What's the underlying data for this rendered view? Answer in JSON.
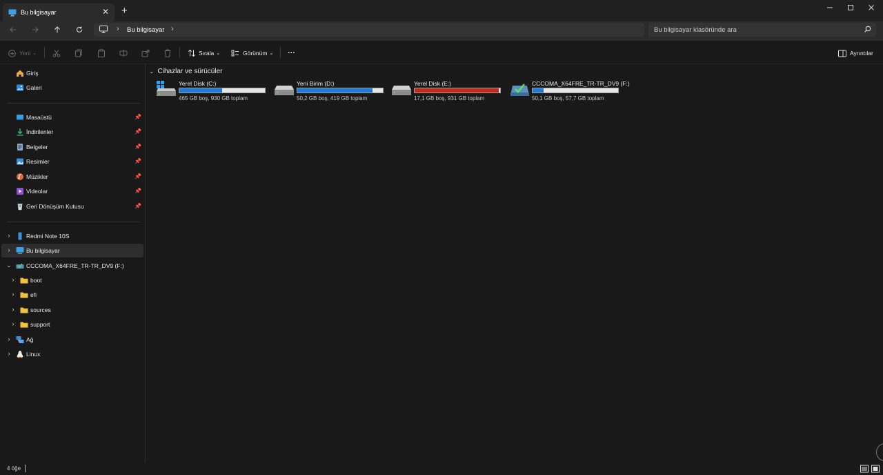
{
  "window": {
    "tab_title": "Bu bilgisayar",
    "tab_icon": "monitor-icon",
    "close_tab": "✕",
    "new_tab": "+",
    "controls": [
      "minimize-icon",
      "maximize-icon",
      "close-icon"
    ]
  },
  "nav": {
    "back_icon": "arrow-left-icon",
    "forward_icon": "arrow-right-icon",
    "up_icon": "arrow-up-icon",
    "refresh_icon": "refresh-icon",
    "address": {
      "crumb": "Bu bilgisayar"
    },
    "search": {
      "placeholder": "Bu bilgisayar klasöründe ara"
    }
  },
  "toolbar": {
    "new_label": "Yeni",
    "sort_label": "Sırala",
    "view_label": "Görünüm",
    "more_label": "···",
    "details_label": "Ayrıntılar"
  },
  "sidebar": {
    "quick": [
      {
        "label": "Giriş",
        "icon": "home-icon"
      },
      {
        "label": "Galeri",
        "icon": "gallery-icon"
      }
    ],
    "pinned": [
      {
        "label": "Masaüstü",
        "icon": "desktop-icon"
      },
      {
        "label": "İndirilenler",
        "icon": "download-icon"
      },
      {
        "label": "Belgeler",
        "icon": "documents-icon"
      },
      {
        "label": "Resimler",
        "icon": "pictures-icon"
      },
      {
        "label": "Müzikler",
        "icon": "music-icon"
      },
      {
        "label": "Videolar",
        "icon": "videos-icon"
      },
      {
        "label": "Geri Dönüşüm Kutusu",
        "icon": "recycle-bin-icon"
      }
    ],
    "tree": [
      {
        "label": "Redmi Note 10S",
        "icon": "phone-icon"
      },
      {
        "label": "Bu bilgisayar",
        "icon": "monitor-icon",
        "selected": true
      },
      {
        "label": "CCCOMA_X64FRE_TR-TR_DV9 (F:)",
        "icon": "dvd-drive-icon",
        "expanded": true
      },
      {
        "label": "boot",
        "icon": "folder-icon"
      },
      {
        "label": "efi",
        "icon": "folder-icon"
      },
      {
        "label": "sources",
        "icon": "folder-icon"
      },
      {
        "label": "support",
        "icon": "folder-icon"
      },
      {
        "label": "Ağ",
        "icon": "network-icon"
      },
      {
        "label": "Linux",
        "icon": "linux-icon"
      }
    ]
  },
  "content": {
    "group_title": "Cihazlar ve sürücüler",
    "drives": [
      {
        "name": "Yerel Disk (C:)",
        "size": "465 GB boş, 930 GB toplam",
        "used_fraction": 0.5,
        "bar_color": "#1e7ad6",
        "icon": "windows-drive-icon"
      },
      {
        "name": "Yeni Birim (D:)",
        "size": "50,2 GB boş, 419 GB toplam",
        "used_fraction": 0.88,
        "bar_color": "#1e7ad6",
        "icon": "hard-drive-icon"
      },
      {
        "name": "Yerel Disk (E:)",
        "size": "17,1 GB boş, 931 GB toplam",
        "used_fraction": 0.98,
        "bar_color": "#c42b1c",
        "icon": "hard-drive-icon"
      },
      {
        "name": "CCCOMA_X64FRE_TR-TR_DV9 (F:)",
        "size": "50,1 GB boş, 57,7 GB toplam",
        "used_fraction": 0.13,
        "bar_color": "#1e7ad6",
        "icon": "dvd-drive-icon"
      }
    ]
  },
  "status": {
    "item_count": "4 öğe"
  }
}
